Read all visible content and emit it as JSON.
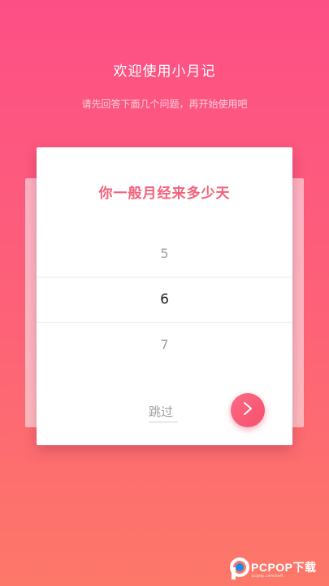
{
  "header": {
    "title": "欢迎使用小月记",
    "subtitle": "请先回答下面几个问题，再开始使用吧"
  },
  "question_card": {
    "question": "你一般月经来多少天",
    "picker": {
      "options": [
        "5",
        "6",
        "7"
      ],
      "selected": "6"
    },
    "skip_label": "跳过",
    "next_icon": "chevron-right-icon"
  },
  "watermark": {
    "text": "PCPOP下载",
    "subtext": "pcpop.com/soft",
    "icon": "pcpop-logo-icon"
  },
  "colors": {
    "background_top": "#fd4f86",
    "background_bottom": "#fd7868",
    "accent": "#f5607a",
    "card": "#ffffff"
  }
}
